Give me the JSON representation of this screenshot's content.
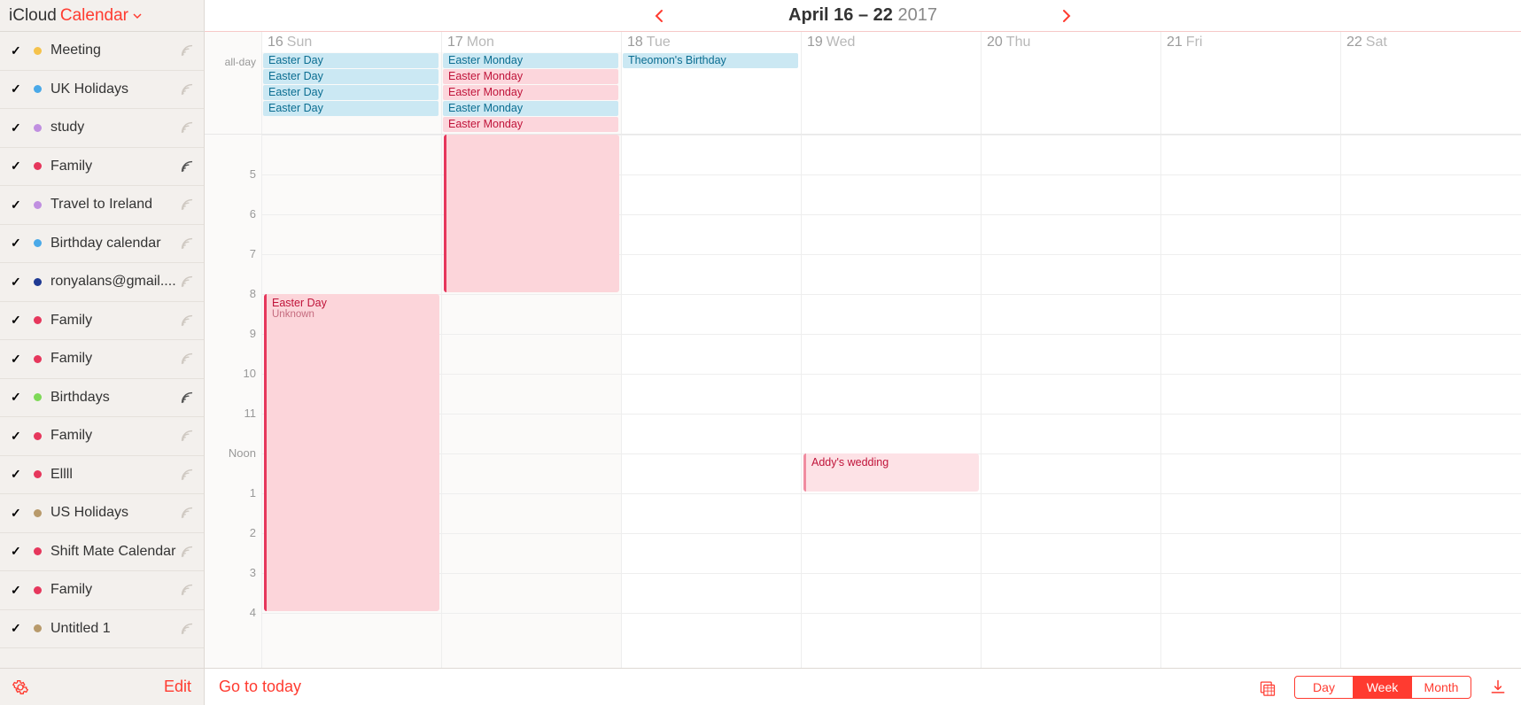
{
  "header": {
    "icloud": "iCloud",
    "calendar": "Calendar"
  },
  "sidebar": {
    "items": [
      {
        "label": "Meeting",
        "color": "#f5c24b",
        "shared": false
      },
      {
        "label": "UK Holidays",
        "color": "#4aa9e8",
        "shared": false
      },
      {
        "label": "study",
        "color": "#c08fe0",
        "shared": false
      },
      {
        "label": "Family",
        "color": "#e6375c",
        "shared": true
      },
      {
        "label": "Travel to Ireland",
        "color": "#c08fe0",
        "shared": false
      },
      {
        "label": "Birthday calendar",
        "color": "#4aa9e8",
        "shared": false
      },
      {
        "label": "ronyalans@gmail....",
        "color": "#1f3a93",
        "shared": false
      },
      {
        "label": "Family",
        "color": "#e6375c",
        "shared": false
      },
      {
        "label": "Family",
        "color": "#e6375c",
        "shared": false
      },
      {
        "label": "Birthdays",
        "color": "#7ed957",
        "shared": true
      },
      {
        "label": "Family",
        "color": "#e6375c",
        "shared": false
      },
      {
        "label": "Ellll",
        "color": "#e6375c",
        "shared": false
      },
      {
        "label": "US Holidays",
        "color": "#b89a6b",
        "shared": false
      },
      {
        "label": "Shift Mate Calendar",
        "color": "#e6375c",
        "shared": false
      },
      {
        "label": "Family",
        "color": "#e6375c",
        "shared": false
      },
      {
        "label": "Untitled 1",
        "color": "#b89a6b",
        "shared": false
      }
    ],
    "edit": "Edit"
  },
  "dateNav": {
    "range": "April 16 – 22",
    "year": "2017"
  },
  "days": [
    {
      "num": "16",
      "name": "Sun",
      "past": true
    },
    {
      "num": "17",
      "name": "Mon",
      "past": true
    },
    {
      "num": "18",
      "name": "Tue",
      "past": false
    },
    {
      "num": "19",
      "name": "Wed",
      "past": false
    },
    {
      "num": "20",
      "name": "Thu",
      "past": false
    },
    {
      "num": "21",
      "name": "Fri",
      "past": false
    },
    {
      "num": "22",
      "name": "Sat",
      "past": false
    }
  ],
  "alldayLabel": "all-day",
  "alldayEvents": [
    [
      {
        "title": "Easter Day",
        "style": "blue"
      },
      {
        "title": "Easter Day",
        "style": "blue"
      },
      {
        "title": "Easter Day",
        "style": "blue"
      },
      {
        "title": "Easter Day",
        "style": "blue"
      }
    ],
    [
      {
        "title": "Easter Monday",
        "style": "blue"
      },
      {
        "title": "Easter Monday",
        "style": "pink"
      },
      {
        "title": "Easter Monday",
        "style": "pink"
      },
      {
        "title": "Easter Monday",
        "style": "blue"
      },
      {
        "title": "Easter Monday",
        "style": "pink"
      }
    ],
    [
      {
        "title": "Theomon's Birthday",
        "style": "blue"
      }
    ],
    [],
    [],
    [],
    []
  ],
  "hours": [
    "",
    "5",
    "6",
    "7",
    "8",
    "9",
    "10",
    "11",
    "Noon",
    "1",
    "2",
    "3",
    "4"
  ],
  "timedEvents": [
    {
      "day": 0,
      "startRow": 4,
      "span": 8,
      "title": "Easter Day",
      "sub": "Unknown",
      "style": "solid"
    },
    {
      "day": 1,
      "startRow": 0,
      "span": 4,
      "title": "",
      "sub": "",
      "style": "solid"
    },
    {
      "day": 3,
      "startRow": 8,
      "span": 1,
      "title": "Addy's wedding",
      "sub": "",
      "style": "light"
    }
  ],
  "footer": {
    "today": "Go to today",
    "views": {
      "day": "Day",
      "week": "Week",
      "month": "Month",
      "active": "week"
    }
  }
}
